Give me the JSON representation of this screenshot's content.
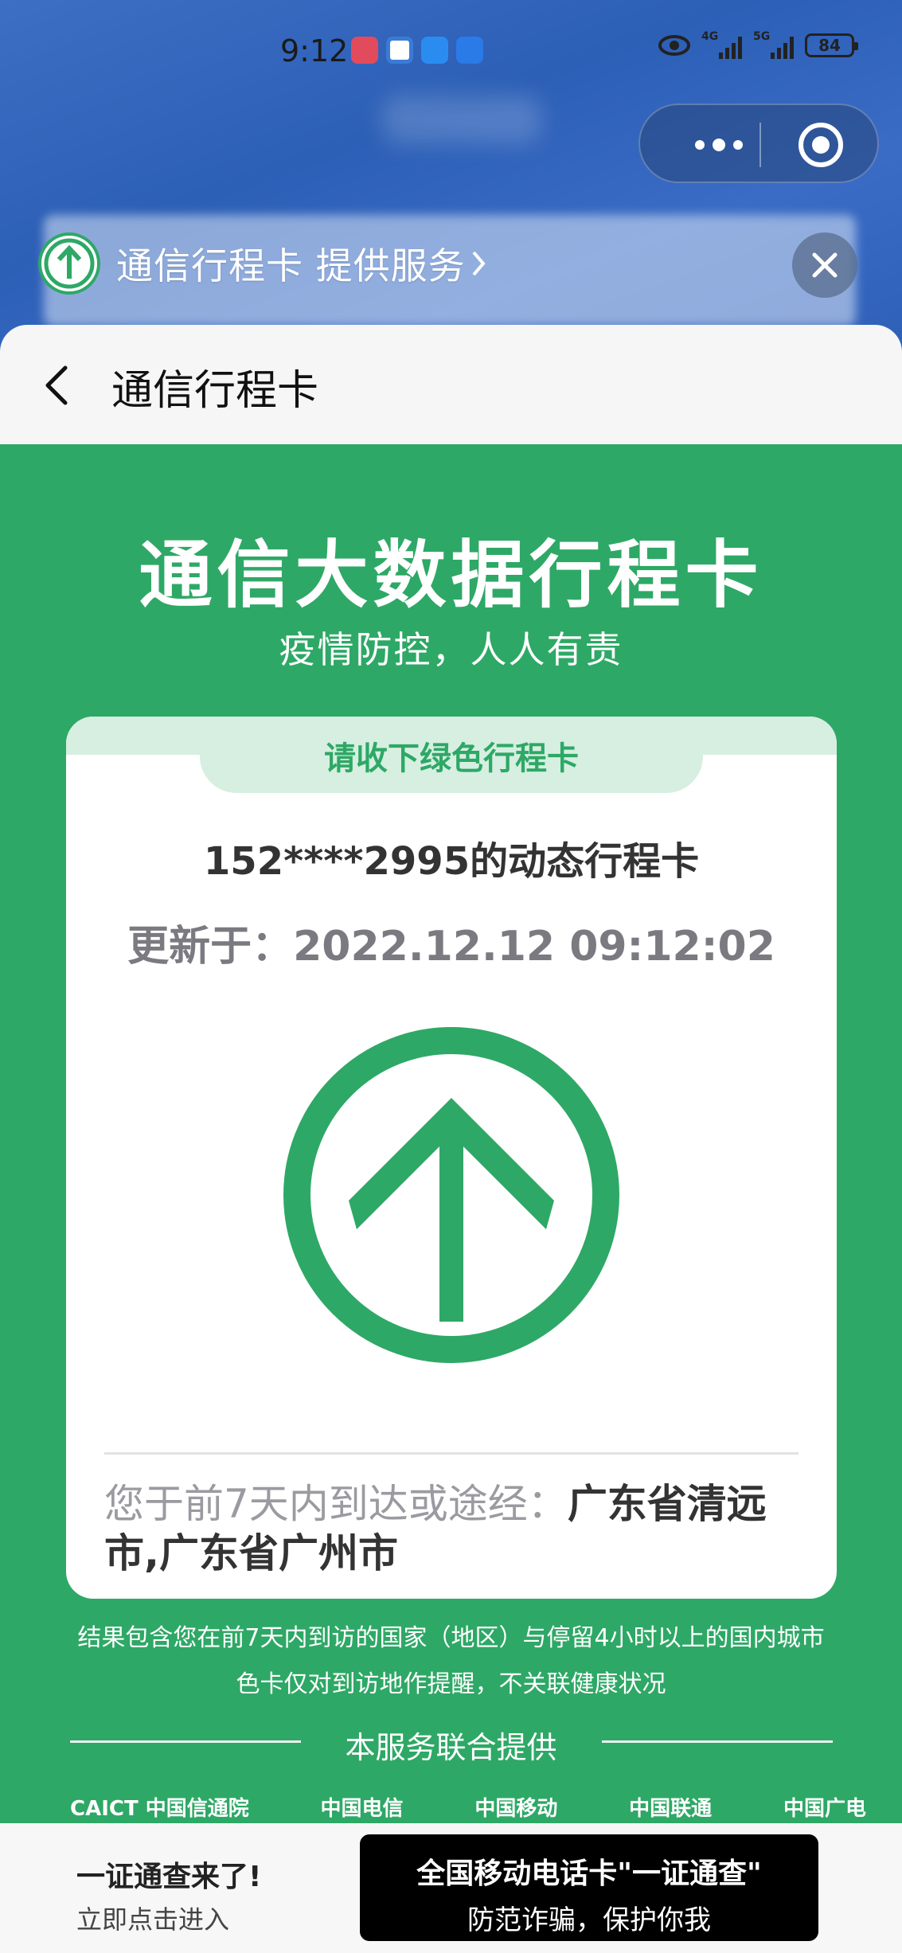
{
  "status_bar": {
    "time": "9:12",
    "network_1": "4G",
    "network_2": "5G",
    "battery": "84"
  },
  "mini_program": {
    "provider_text": "通信行程卡 提供服务",
    "nav_title": "通信行程卡"
  },
  "page": {
    "headline": "通信大数据行程卡",
    "slogan": "疫情防控，人人有责",
    "card": {
      "tab_text": "请收下绿色行程卡",
      "phone_line": "152****2995的动态行程卡",
      "updated_line": "更新于：2022.12.12 09:12:02",
      "arrow_color": "#2ea866",
      "visits_prefix": "您于前7天内到达或途经：",
      "visits_places": "广东省清远市,广东省广州市"
    },
    "note_1": "结果包含您在前7天内到访的国家（地区）与停留4小时以上的国内城市",
    "note_2": "色卡仅对到访地作提醒，不关联健康状况",
    "joint_label": "本服务联合提供",
    "partners": [
      {
        "name": "CAICT 中国信通院",
        "icon": "caict-logo"
      },
      {
        "name": "中国电信",
        "icon": "china-telecom-logo"
      },
      {
        "name": "中国移动",
        "icon": "china-mobile-logo"
      },
      {
        "name": "中国联通",
        "icon": "china-unicom-logo"
      },
      {
        "name": "中国广电",
        "icon": "china-broadnet-logo"
      }
    ]
  },
  "bottom_bar": {
    "left_title": "一证通查来了!",
    "left_subtitle": "立即点击进入",
    "promo_title": "全国移动电话卡\"一证通查\"",
    "promo_subtitle": "防范诈骗，保护你我"
  },
  "colors": {
    "brand_green": "#2ea866",
    "tab_green_light": "#d6efe1",
    "header_blue": "#2c5fb6"
  }
}
